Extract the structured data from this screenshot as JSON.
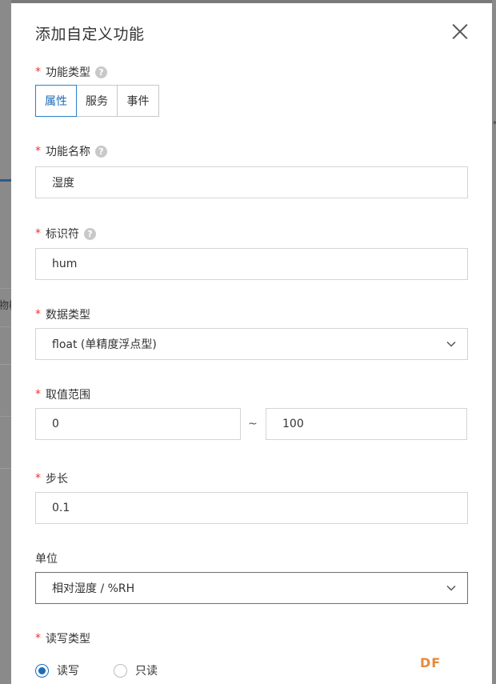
{
  "dialog": {
    "title": "添加自定义功能"
  },
  "background": {
    "fragment_text": "物模"
  },
  "function_type": {
    "label": "功能类型",
    "options": [
      "属性",
      "服务",
      "事件"
    ],
    "selected": "属性"
  },
  "function_name": {
    "label": "功能名称",
    "value": "湿度"
  },
  "identifier": {
    "label": "标识符",
    "value": "hum"
  },
  "data_type": {
    "label": "数据类型",
    "value": "float (单精度浮点型)"
  },
  "value_range": {
    "label": "取值范围",
    "min": "0",
    "separator": "~",
    "max": "100"
  },
  "step": {
    "label": "步长",
    "value": "0.1"
  },
  "unit": {
    "label": "单位",
    "value": "相对湿度 / %RH"
  },
  "rw_type": {
    "label": "读写类型",
    "options": [
      "读写",
      "只读"
    ],
    "selected": "读写"
  },
  "common": {
    "required_mark": "*",
    "help_glyph": "?"
  },
  "watermark": "DF",
  "colors": {
    "accent": "#1a6db8",
    "required": "#e33333",
    "overlay": "#7a7a7a"
  }
}
